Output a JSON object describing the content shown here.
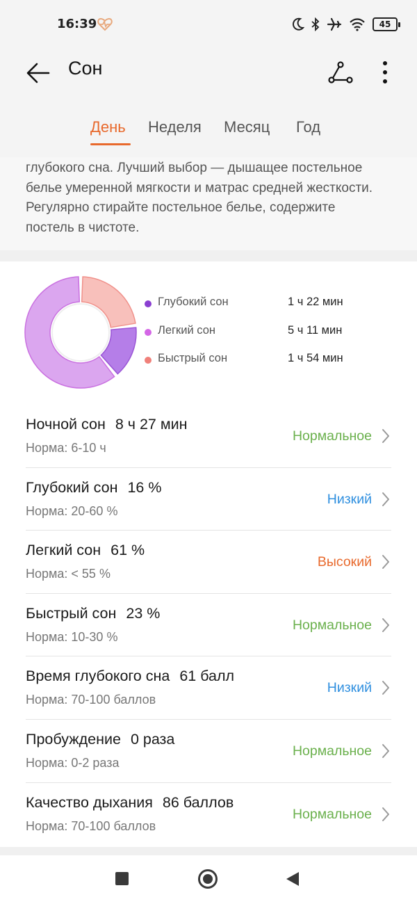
{
  "status_bar": {
    "time": "16:39",
    "battery": "45",
    "icons": [
      "heart-pulse-icon",
      "moon-icon",
      "bluetooth-icon",
      "airplane-icon",
      "wifi-icon",
      "battery-icon"
    ]
  },
  "header": {
    "title": "Сон",
    "back_icon": "arrow-left-icon",
    "share_icon": "share-icon",
    "more_icon": "more-vertical-icon"
  },
  "tabs": [
    {
      "label": "День",
      "active": true
    },
    {
      "label": "Неделя",
      "active": false
    },
    {
      "label": "Месяц",
      "active": false
    },
    {
      "label": "Год",
      "active": false
    }
  ],
  "advice": {
    "text": "глубокого сна. Лучший выбор — дышащее постельное белье умеренной мягкости и матрас средней жесткости. Регулярно стирайте постельное белье, содержите постель в чистоте."
  },
  "chart_data": {
    "type": "pie",
    "donut": true,
    "categories": [
      "Глубокий сон",
      "Легкий сон",
      "Быстрый сон"
    ],
    "values": [
      16,
      61,
      23
    ],
    "durations": [
      "1 ч 22 мин",
      "5 ч 11 мин",
      "1 ч 54 мин"
    ],
    "colors": [
      "#b57ee8",
      "#dba6ef",
      "#f8c0bb"
    ],
    "legend_dot_colors": [
      "#8a3fd1",
      "#d466e6",
      "#f0807a"
    ],
    "legend_placement": "right"
  },
  "metrics": [
    {
      "label": "Ночной сон",
      "value": "8 ч 27 мин",
      "norm": "Норма: 6-10 ч",
      "status": "Нормальное",
      "status_color": "#6ab04c"
    },
    {
      "label": "Глубокий сон",
      "value": "16 %",
      "norm": "Норма: 20-60 %",
      "status": "Низкий",
      "status_color": "#2f8fdf"
    },
    {
      "label": "Легкий сон",
      "value": "61 %",
      "norm": "Норма: < 55 %",
      "status": "Высокий",
      "status_color": "#e8692c"
    },
    {
      "label": "Быстрый сон",
      "value": "23 %",
      "norm": "Норма: 10-30 %",
      "status": "Нормальное",
      "status_color": "#6ab04c"
    },
    {
      "label": "Время глубокого сна",
      "value": "61 балл",
      "norm": "Норма: 70-100 баллов",
      "status": "Низкий",
      "status_color": "#2f8fdf"
    },
    {
      "label": "Пробуждение",
      "value": "0 раза",
      "norm": "Норма: 0-2 раза",
      "status": "Нормальное",
      "status_color": "#6ab04c"
    },
    {
      "label": "Качество дыхания",
      "value": "86 баллов",
      "norm": "Норма: 70-100 баллов",
      "status": "Нормальное",
      "status_color": "#6ab04c"
    }
  ],
  "colors": {
    "accent": "#e8692c",
    "normal": "#6ab04c",
    "low": "#2f8fdf",
    "high": "#e8692c"
  },
  "nav": {
    "icons": [
      "recent-apps-icon",
      "home-icon",
      "back-triangle-icon"
    ]
  }
}
